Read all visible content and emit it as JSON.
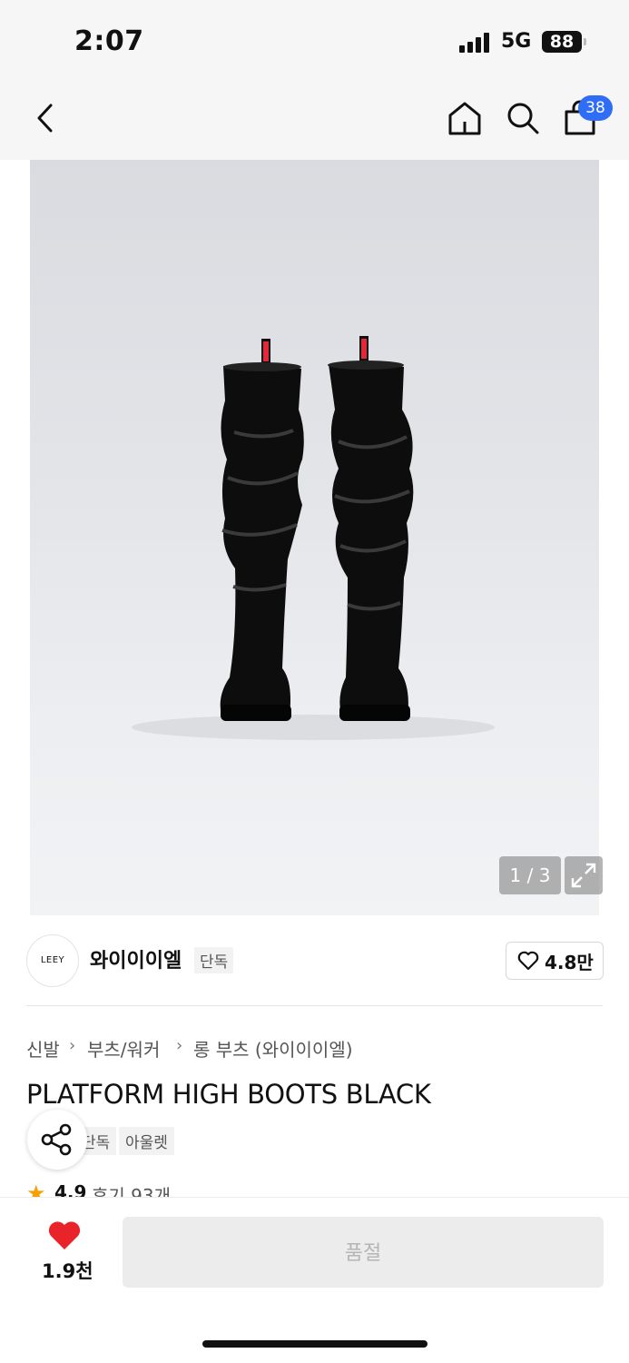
{
  "status_bar": {
    "time": "2:07",
    "network": "5G",
    "battery": "88"
  },
  "nav": {
    "cart_count": "38",
    "icons": [
      "back-icon",
      "home-icon",
      "search-icon",
      "cart-icon"
    ]
  },
  "gallery": {
    "counter": "1 / 3"
  },
  "brand": {
    "logo_text": "LEEY",
    "name": "와이이이엘",
    "tag": "단독",
    "likes": "4.8만"
  },
  "breadcrumb": [
    "신발",
    "부츠/워커",
    "롱 부츠 (와이이이엘)"
  ],
  "product": {
    "title": "PLATFORM HIGH BOOTS BLACK",
    "tags": [
      "단독",
      "아울렛"
    ],
    "rating": "4.9",
    "reviews": "후기 93개"
  },
  "bottom_bar": {
    "wish_count": "1.9천",
    "buy_label": "품절"
  },
  "colors": {
    "accent": "#2f6df6",
    "heart": "#e8242a",
    "star": "#f5a100"
  }
}
